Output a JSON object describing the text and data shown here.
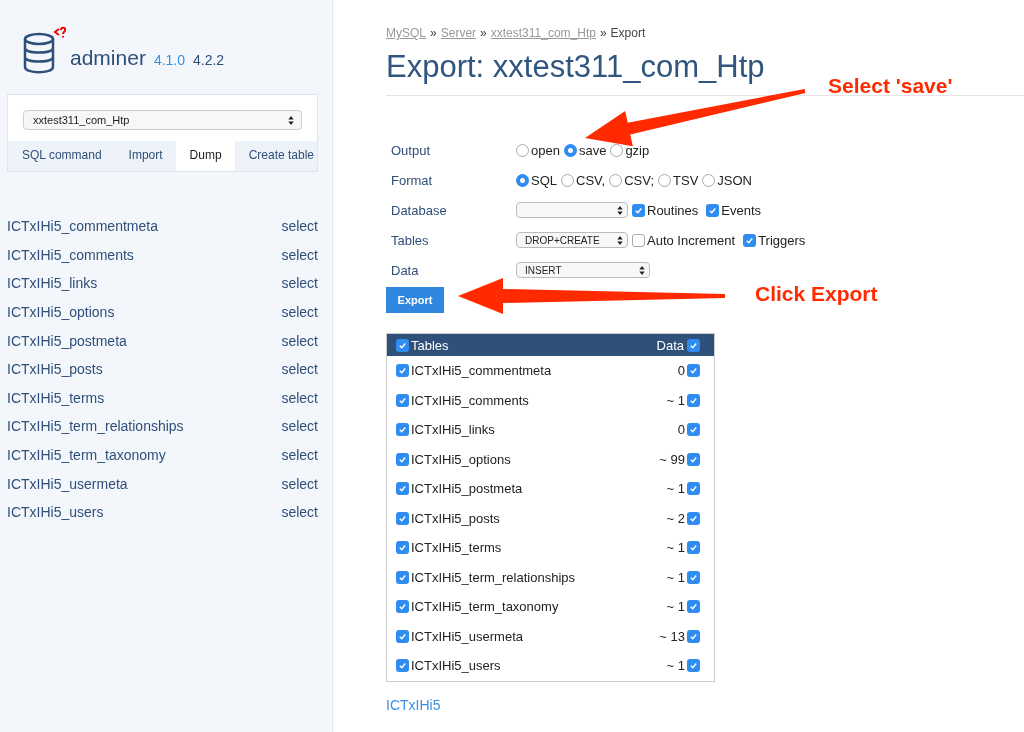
{
  "logo": {
    "name": "adminer",
    "version_old": "4.1.0",
    "version_new": "4.2.2"
  },
  "sidebar": {
    "database_select": "xxtest311_com_Htp",
    "menu": [
      {
        "label": "SQL command",
        "selected": false
      },
      {
        "label": "Import",
        "selected": false
      },
      {
        "label": "Dump",
        "selected": true
      },
      {
        "label": "Create table",
        "selected": false
      }
    ],
    "tables": [
      {
        "name": "ICTxIHi5_commentmeta",
        "action": "select"
      },
      {
        "name": "ICTxIHi5_comments",
        "action": "select"
      },
      {
        "name": "ICTxIHi5_links",
        "action": "select"
      },
      {
        "name": "ICTxIHi5_options",
        "action": "select"
      },
      {
        "name": "ICTxIHi5_postmeta",
        "action": "select"
      },
      {
        "name": "ICTxIHi5_posts",
        "action": "select"
      },
      {
        "name": "ICTxIHi5_terms",
        "action": "select"
      },
      {
        "name": "ICTxIHi5_term_relationships",
        "action": "select"
      },
      {
        "name": "ICTxIHi5_term_taxonomy",
        "action": "select"
      },
      {
        "name": "ICTxIHi5_usermeta",
        "action": "select"
      },
      {
        "name": "ICTxIHi5_users",
        "action": "select"
      }
    ]
  },
  "breadcrumb": [
    {
      "label": "MySQL",
      "link": true
    },
    {
      "label": "Server",
      "link": true
    },
    {
      "label": "xxtest311_com_Htp",
      "link": true
    },
    {
      "label": "Export",
      "link": false
    }
  ],
  "breadcrumb_separator": "»",
  "title": "Export: xxtest311_com_Htp",
  "form_rows": [
    {
      "label": "Output",
      "kind": "radio",
      "options": [
        {
          "label": "open",
          "selected": false
        },
        {
          "label": "save",
          "selected": true
        },
        {
          "label": "gzip",
          "selected": false
        }
      ]
    },
    {
      "label": "Format",
      "kind": "radio",
      "options": [
        {
          "label": "SQL",
          "selected": true
        },
        {
          "label": "CSV,",
          "selected": false
        },
        {
          "label": "CSV;",
          "selected": false
        },
        {
          "label": "TSV",
          "selected": false
        },
        {
          "label": "JSON",
          "selected": false
        }
      ]
    },
    {
      "label": "Database",
      "kind": "select",
      "checks": [
        {
          "label": "Routines",
          "checked": true
        },
        {
          "label": "Events",
          "checked": true
        }
      ]
    },
    {
      "label": "Tables",
      "kind": "select",
      "value": "DROP+CREATE",
      "checks": [
        {
          "label": "Auto Increment",
          "checked": false
        },
        {
          "label": "Triggers",
          "checked": true
        }
      ]
    },
    {
      "label": "Data",
      "kind": "select",
      "value": "INSERT"
    }
  ],
  "export_button": "Export",
  "tables_table": {
    "header": {
      "label": "Tables",
      "checked": true,
      "data_label": "Data",
      "data_checked": true
    },
    "rows": [
      {
        "name": "ICTxIHi5_commentmeta",
        "checked": true,
        "count": "0",
        "data_checked": true
      },
      {
        "name": "ICTxIHi5_comments",
        "checked": true,
        "count": "~ 1",
        "data_checked": true
      },
      {
        "name": "ICTxIHi5_links",
        "checked": true,
        "count": "0",
        "data_checked": true
      },
      {
        "name": "ICTxIHi5_options",
        "checked": true,
        "count": "~ 99",
        "data_checked": true
      },
      {
        "name": "ICTxIHi5_postmeta",
        "checked": true,
        "count": "~ 1",
        "data_checked": true
      },
      {
        "name": "ICTxIHi5_posts",
        "checked": true,
        "count": "~ 2",
        "data_checked": true
      },
      {
        "name": "ICTxIHi5_terms",
        "checked": true,
        "count": "~ 1",
        "data_checked": true
      },
      {
        "name": "ICTxIHi5_term_relationships",
        "checked": true,
        "count": "~ 1",
        "data_checked": true
      },
      {
        "name": "ICTxIHi5_term_taxonomy",
        "checked": true,
        "count": "~ 1",
        "data_checked": true
      },
      {
        "name": "ICTxIHi5_usermeta",
        "checked": true,
        "count": "~ 13",
        "data_checked": true
      },
      {
        "name": "ICTxIHi5_users",
        "checked": true,
        "count": "~ 1",
        "data_checked": true
      }
    ]
  },
  "footer_link": "ICTxIHi5",
  "annotations": [
    {
      "text": "Select 'save'"
    },
    {
      "text": "Click Export"
    }
  ]
}
